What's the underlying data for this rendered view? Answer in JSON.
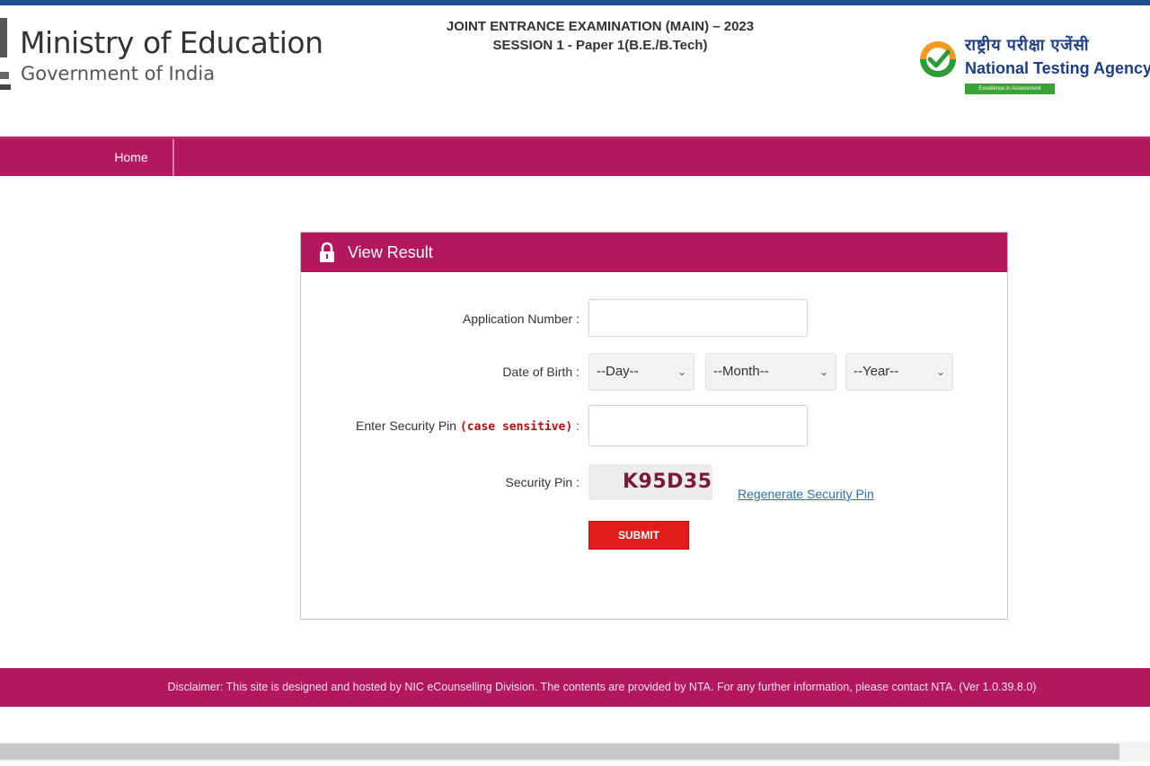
{
  "header": {
    "ministry_title": "Ministry of Education",
    "ministry_subtitle": "Government of India",
    "exam_title_line1": "JOINT ENTRANCE EXAMINATION (MAIN) – 2023",
    "exam_title_line2": "SESSION 1 - Paper 1(B.E./B.Tech)",
    "agency_hindi": "राष्ट्रीय परीक्षा एजेंसी",
    "agency_name": "National Testing Agency",
    "agency_tagline": "Excellence in Assessment"
  },
  "nav": {
    "home_label": "Home"
  },
  "panel": {
    "title": "View Result",
    "application_number_label": "Application Number :",
    "application_number_value": "",
    "dob_label": "Date of Birth :",
    "dob_day": "--Day--",
    "dob_month": "--Month--",
    "dob_year": "--Year--",
    "enter_pin_label": "Enter Security Pin",
    "enter_pin_note": "(case sensitive)",
    "enter_pin_colon": ":",
    "enter_pin_value": "",
    "security_pin_label": "Security Pin :",
    "security_pin_captcha": "K95D35",
    "regenerate_label": "Regenerate Security Pin",
    "submit_label": "SUBMIT"
  },
  "footer": {
    "disclaimer": "Disclaimer: This site is designed and hosted by NIC eCounselling Division. The contents are provided by NTA. For any further information, please contact NTA. (Ver 1.0.39.8.0)"
  },
  "colors": {
    "brand_magenta": "#b3185e",
    "submit_red": "#e21b1b",
    "agency_blue": "#1d3f86",
    "link_blue": "#2d6fb0"
  },
  "icons": [
    "national-emblem-icon",
    "nta-check-logo-icon",
    "lock-icon",
    "chevron-down-icon"
  ]
}
